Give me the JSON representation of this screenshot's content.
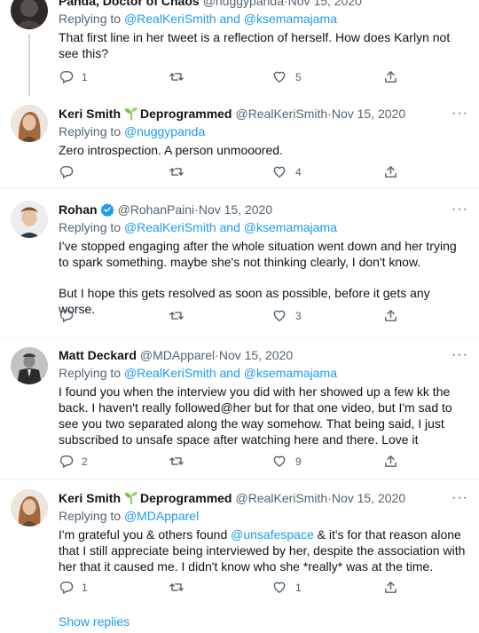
{
  "tweets": [
    {
      "name": "Panda, Doctor of Chaos",
      "handle": "@nuggypanda",
      "date": "Nov 15, 2020",
      "replying_prefix": "Replying to",
      "replying_to": "@RealKeriSmith and @ksemamajama",
      "text": [
        "That first line in her tweet is a reflection of herself. How does Karlyn not see this?"
      ],
      "replies": "1",
      "retweets": "",
      "likes": "5"
    },
    {
      "name": "Keri Smith",
      "badge_text": "Deprogrammed",
      "handle": "@RealKeriSmith",
      "date": "Nov 15, 2020",
      "replying_prefix": "Replying to",
      "replying_to": "@nuggypanda",
      "text": [
        "Zero introspection. A person unmooored."
      ],
      "replies": "",
      "retweets": "",
      "likes": "4"
    },
    {
      "name": "Rohan",
      "handle": "@RohanPaini",
      "date": "Nov 15, 2020",
      "replying_prefix": "Replying to",
      "replying_to": "@RealKeriSmith and @ksemamajama",
      "text": [
        "I've stopped engaging after the whole situation went down and her trying to spark something. maybe she's not thinking clearly, I don't know.",
        "But I hope this gets resolved as soon as possible, before it gets any worse."
      ],
      "replies": "",
      "retweets": "",
      "likes": "3"
    },
    {
      "name": "Matt Deckard",
      "handle": "@MDApparel",
      "date": "Nov 15, 2020",
      "replying_prefix": "Replying to",
      "replying_to": "@RealKeriSmith and @ksemamajama",
      "text": [
        "I found you when the interview you did with her showed up a few kk the back. I haven't really followed@her but for that one video, but I'm sad to see you two separated along the way somehow. That being said, I just subscribed to unsafe space after watching here and there. Love it"
      ],
      "replies": "2",
      "retweets": "",
      "likes": "9"
    },
    {
      "name": "Keri Smith",
      "badge_text": "Deprogrammed",
      "handle": "@RealKeriSmith",
      "date": "Nov 15, 2020",
      "replying_prefix": "Replying to",
      "replying_to": "@MDApparel",
      "text_before": "I'm grateful you & others found ",
      "text_link": "@unsafespace",
      "text_after": " & it's for that reason alone that I still appreciate being interviewed by her, despite the association with her that it caused me. I didn't know who she *really* was at the time.",
      "replies": "1",
      "retweets": "",
      "likes": "1"
    }
  ],
  "separator": " · ",
  "more_label": "···",
  "show_replies": "Show replies",
  "colors": {
    "link": "#1d9bf0",
    "secondary": "#536471",
    "border": "#eff3f4",
    "verified": "#1d9bf0",
    "sprout": "#6cc24a"
  }
}
